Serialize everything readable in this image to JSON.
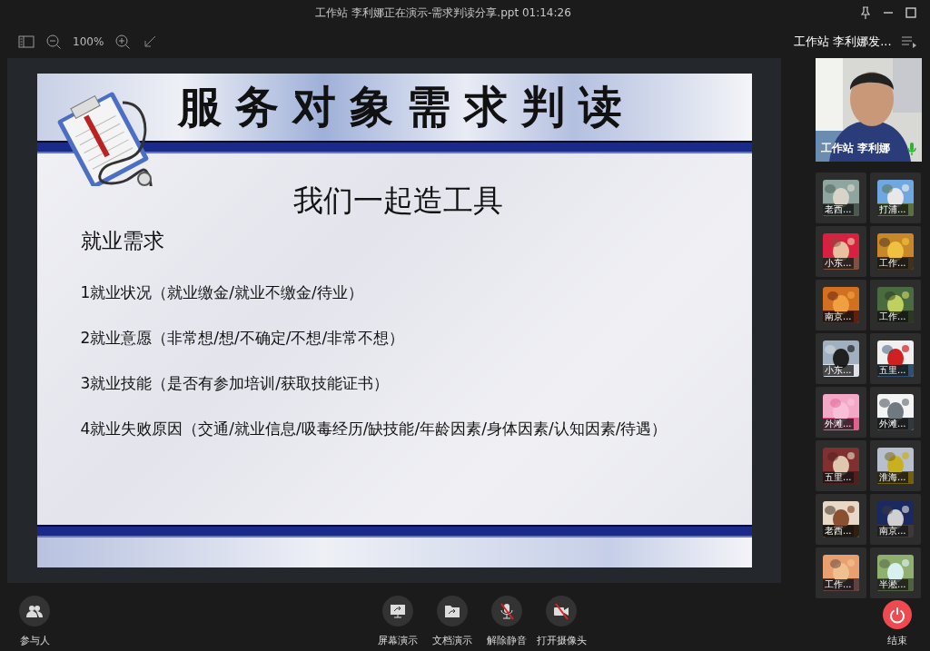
{
  "window": {
    "title": "工作站 李利娜正在演示-需求判读分享.ppt 01:14:26"
  },
  "toolbar": {
    "zoom": "100%"
  },
  "slide": {
    "title": "服务对象需求判读",
    "subtitle": "我们一起造工具",
    "heading": "就业需求",
    "items": [
      "1就业状况（就业缴金/就业不缴金/待业）",
      "2就业意愿（非常想/想/不确定/不想/非常不想）",
      "3就业技能（是否有参加培训/获取技能证书）",
      "4就业失败原因（交通/就业信息/吸毒经历/缺技能/年龄因素/身体因素/认知因素/待遇）"
    ]
  },
  "sidebar": {
    "header": "工作站 李利娜发...",
    "presenter": {
      "name": "工作站 李利娜",
      "mic_on": true
    },
    "participants": [
      {
        "label": "老西..."
      },
      {
        "label": "打浦..."
      },
      {
        "label": "小东..."
      },
      {
        "label": "工作..."
      },
      {
        "label": "南京..."
      },
      {
        "label": "工作..."
      },
      {
        "label": "小东..."
      },
      {
        "label": "五里..."
      },
      {
        "label": "外滩..."
      },
      {
        "label": "外滩..."
      },
      {
        "label": "五里..."
      },
      {
        "label": "淮海..."
      },
      {
        "label": "老西..."
      },
      {
        "label": "南京..."
      },
      {
        "label": "工作..."
      },
      {
        "label": "半淞..."
      }
    ]
  },
  "controls": [
    {
      "kind": "participants",
      "label": "参与人",
      "off": false
    },
    {
      "kind": "screen",
      "label": "屏幕演示",
      "off": false
    },
    {
      "kind": "document",
      "label": "文档演示",
      "off": false
    },
    {
      "kind": "mic",
      "label": "解除静音",
      "off": true
    },
    {
      "kind": "camera",
      "label": "打开摄像头",
      "off": true
    },
    {
      "kind": "end",
      "label": "结束",
      "off": false
    }
  ]
}
